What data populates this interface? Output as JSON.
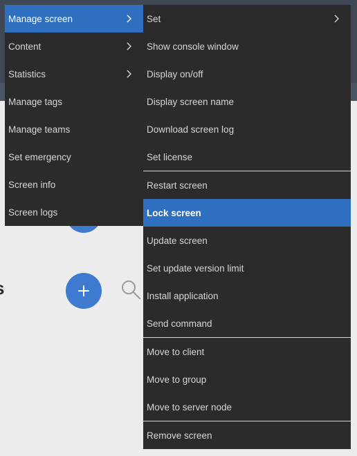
{
  "background": {
    "heading_fragment": "s"
  },
  "main_menu": {
    "items": [
      {
        "label": "Manage screen",
        "submenu": true,
        "active": true
      },
      {
        "label": "Content",
        "submenu": true
      },
      {
        "label": "Statistics",
        "submenu": true
      },
      {
        "label": "Manage tags"
      },
      {
        "label": "Manage teams"
      },
      {
        "label": "Set emergency"
      },
      {
        "label": "Screen info"
      },
      {
        "label": "Screen logs"
      }
    ]
  },
  "sub_menu": {
    "items": [
      {
        "label": "Set",
        "submenu": true
      },
      {
        "label": "Show console window"
      },
      {
        "label": "Display on/off"
      },
      {
        "label": "Display screen name"
      },
      {
        "label": "Download screen log"
      },
      {
        "label": "Set license"
      },
      {
        "label": "Restart screen"
      },
      {
        "label": "Lock screen",
        "active": true
      },
      {
        "label": "Update screen"
      },
      {
        "label": "Set update version limit"
      },
      {
        "label": "Install application"
      },
      {
        "label": "Send command"
      },
      {
        "label": "Move to client"
      },
      {
        "label": "Move to group"
      },
      {
        "label": "Move to server node"
      },
      {
        "label": "Remove screen"
      }
    ]
  },
  "colors": {
    "menu_bg": "#2b2b2b",
    "active": "#2f6fbf",
    "fab": "#3e7bd0"
  }
}
